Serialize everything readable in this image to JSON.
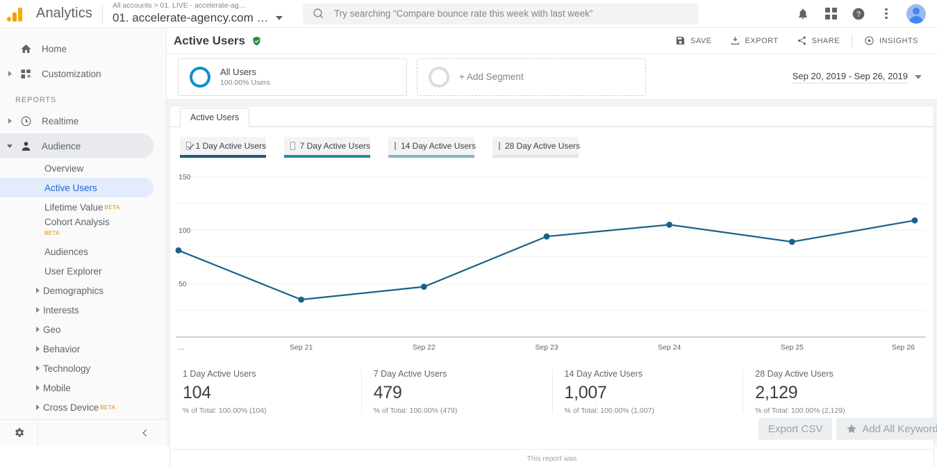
{
  "topbar": {
    "brand": "Analytics",
    "account_breadcrumb": "All accounts > 01. LIVE - accelerate-ag…",
    "account_name": "01. accelerate-agency.com …",
    "search_placeholder": "Try searching “Compare bounce rate this week with last week”",
    "icons": {
      "search": "search-icon",
      "notifications": "bell-icon",
      "apps": "apps-grid-icon",
      "help": "help-icon",
      "more": "kebab-menu-icon",
      "account": "user-avatar"
    }
  },
  "sidebar": {
    "items": [
      {
        "label": "Home",
        "icon": "home-icon",
        "expandable": false
      },
      {
        "label": "Customization",
        "icon": "customization-icon",
        "expandable": true
      }
    ],
    "section_title": "REPORTS",
    "reports": [
      {
        "label": "Realtime",
        "icon": "clock-icon",
        "expandable": true
      },
      {
        "label": "Audience",
        "icon": "person-icon",
        "expandable": true,
        "expanded": true
      }
    ],
    "audience_children": [
      {
        "label": "Overview",
        "beta": "",
        "expandable": false,
        "selected": false
      },
      {
        "label": "Active Users",
        "beta": "",
        "expandable": false,
        "selected": true
      },
      {
        "label": "Lifetime Value",
        "beta": "BETA",
        "beta_position": "super",
        "expandable": false,
        "selected": false
      },
      {
        "label": "Cohort Analysis",
        "beta": "BETA",
        "beta_position": "below",
        "expandable": false,
        "selected": false
      },
      {
        "label": "Audiences",
        "beta": "",
        "expandable": false,
        "selected": false
      },
      {
        "label": "User Explorer",
        "beta": "",
        "expandable": false,
        "selected": false
      },
      {
        "label": "Demographics",
        "beta": "",
        "expandable": true,
        "selected": false
      },
      {
        "label": "Interests",
        "beta": "",
        "expandable": true,
        "selected": false
      },
      {
        "label": "Geo",
        "beta": "",
        "expandable": true,
        "selected": false
      },
      {
        "label": "Behavior",
        "beta": "",
        "expandable": true,
        "selected": false
      },
      {
        "label": "Technology",
        "beta": "",
        "expandable": true,
        "selected": false
      },
      {
        "label": "Mobile",
        "beta": "",
        "expandable": true,
        "selected": false
      },
      {
        "label": "Cross Device",
        "beta": "BETA",
        "beta_position": "super",
        "expandable": true,
        "selected": false
      }
    ],
    "footer": {
      "settings_icon": "gear-icon",
      "collapse_icon": "chevron-left-icon"
    }
  },
  "page": {
    "title": "Active Users",
    "verified_icon": "verified-shield-icon",
    "actions": [
      {
        "label": "SAVE",
        "icon": "save-icon"
      },
      {
        "label": "EXPORT",
        "icon": "download-icon"
      },
      {
        "label": "SHARE",
        "icon": "share-icon"
      },
      {
        "label": "INSIGHTS",
        "icon": "insights-icon"
      }
    ]
  },
  "segments": {
    "applied": {
      "name": "All Users",
      "sub": "100.00% Users",
      "ring_color": "#0d8ecf"
    },
    "add": {
      "label": "+ Add Segment"
    },
    "date_range": "Sep 20, 2019 - Sep 26, 2019"
  },
  "panel": {
    "tab": "Active Users",
    "metric_tabs": [
      {
        "label": "1 Day Active Users",
        "checked": true,
        "color": "#1a5b77"
      },
      {
        "label": "7 Day Active Users",
        "checked": false,
        "color": "#2388ad"
      },
      {
        "label": "14 Day Active Users",
        "checked": false,
        "color": "#7db8d1"
      },
      {
        "label": "28 Day Active Users",
        "checked": false,
        "color": "#dbe6ed"
      }
    ],
    "summary": [
      {
        "key": "1 Day Active Users",
        "value": "104",
        "pct": "% of Total: 100.00% (104)"
      },
      {
        "key": "7 Day Active Users",
        "value": "479",
        "pct": "% of Total: 100.00% (479)"
      },
      {
        "key": "14 Day Active Users",
        "value": "1,007",
        "pct": "% of Total: 100.00% (1,007)"
      },
      {
        "key": "28 Day Active Users",
        "value": "2,129",
        "pct": "% of Total: 100.00% (2,129)"
      }
    ],
    "footer_text": "This report was"
  },
  "overlay": {
    "export_csv": "Export CSV",
    "add_all_keywords": "Add All Keywords",
    "star_icon": "star-icon"
  },
  "chart_data": {
    "type": "line",
    "title": "Active Users",
    "series": [
      {
        "name": "1 Day Active Users",
        "values": [
          81,
          35,
          47,
          94,
          105,
          89,
          109
        ],
        "color": "#19618a"
      }
    ],
    "categories": [
      "…",
      "Sep 21",
      "Sep 22",
      "Sep 23",
      "Sep 24",
      "Sep 25",
      "Sep 26"
    ],
    "x_tick_labels": [
      "…",
      "Sep 21",
      "Sep 22",
      "Sep 23",
      "Sep 24",
      "Sep 25",
      "Sep 26"
    ],
    "y_tick_labels": [
      "50",
      "100",
      "150"
    ],
    "ylim": [
      0,
      152
    ],
    "ylabel": "",
    "xlabel": "",
    "grid": true,
    "legend": false,
    "markers": true
  }
}
